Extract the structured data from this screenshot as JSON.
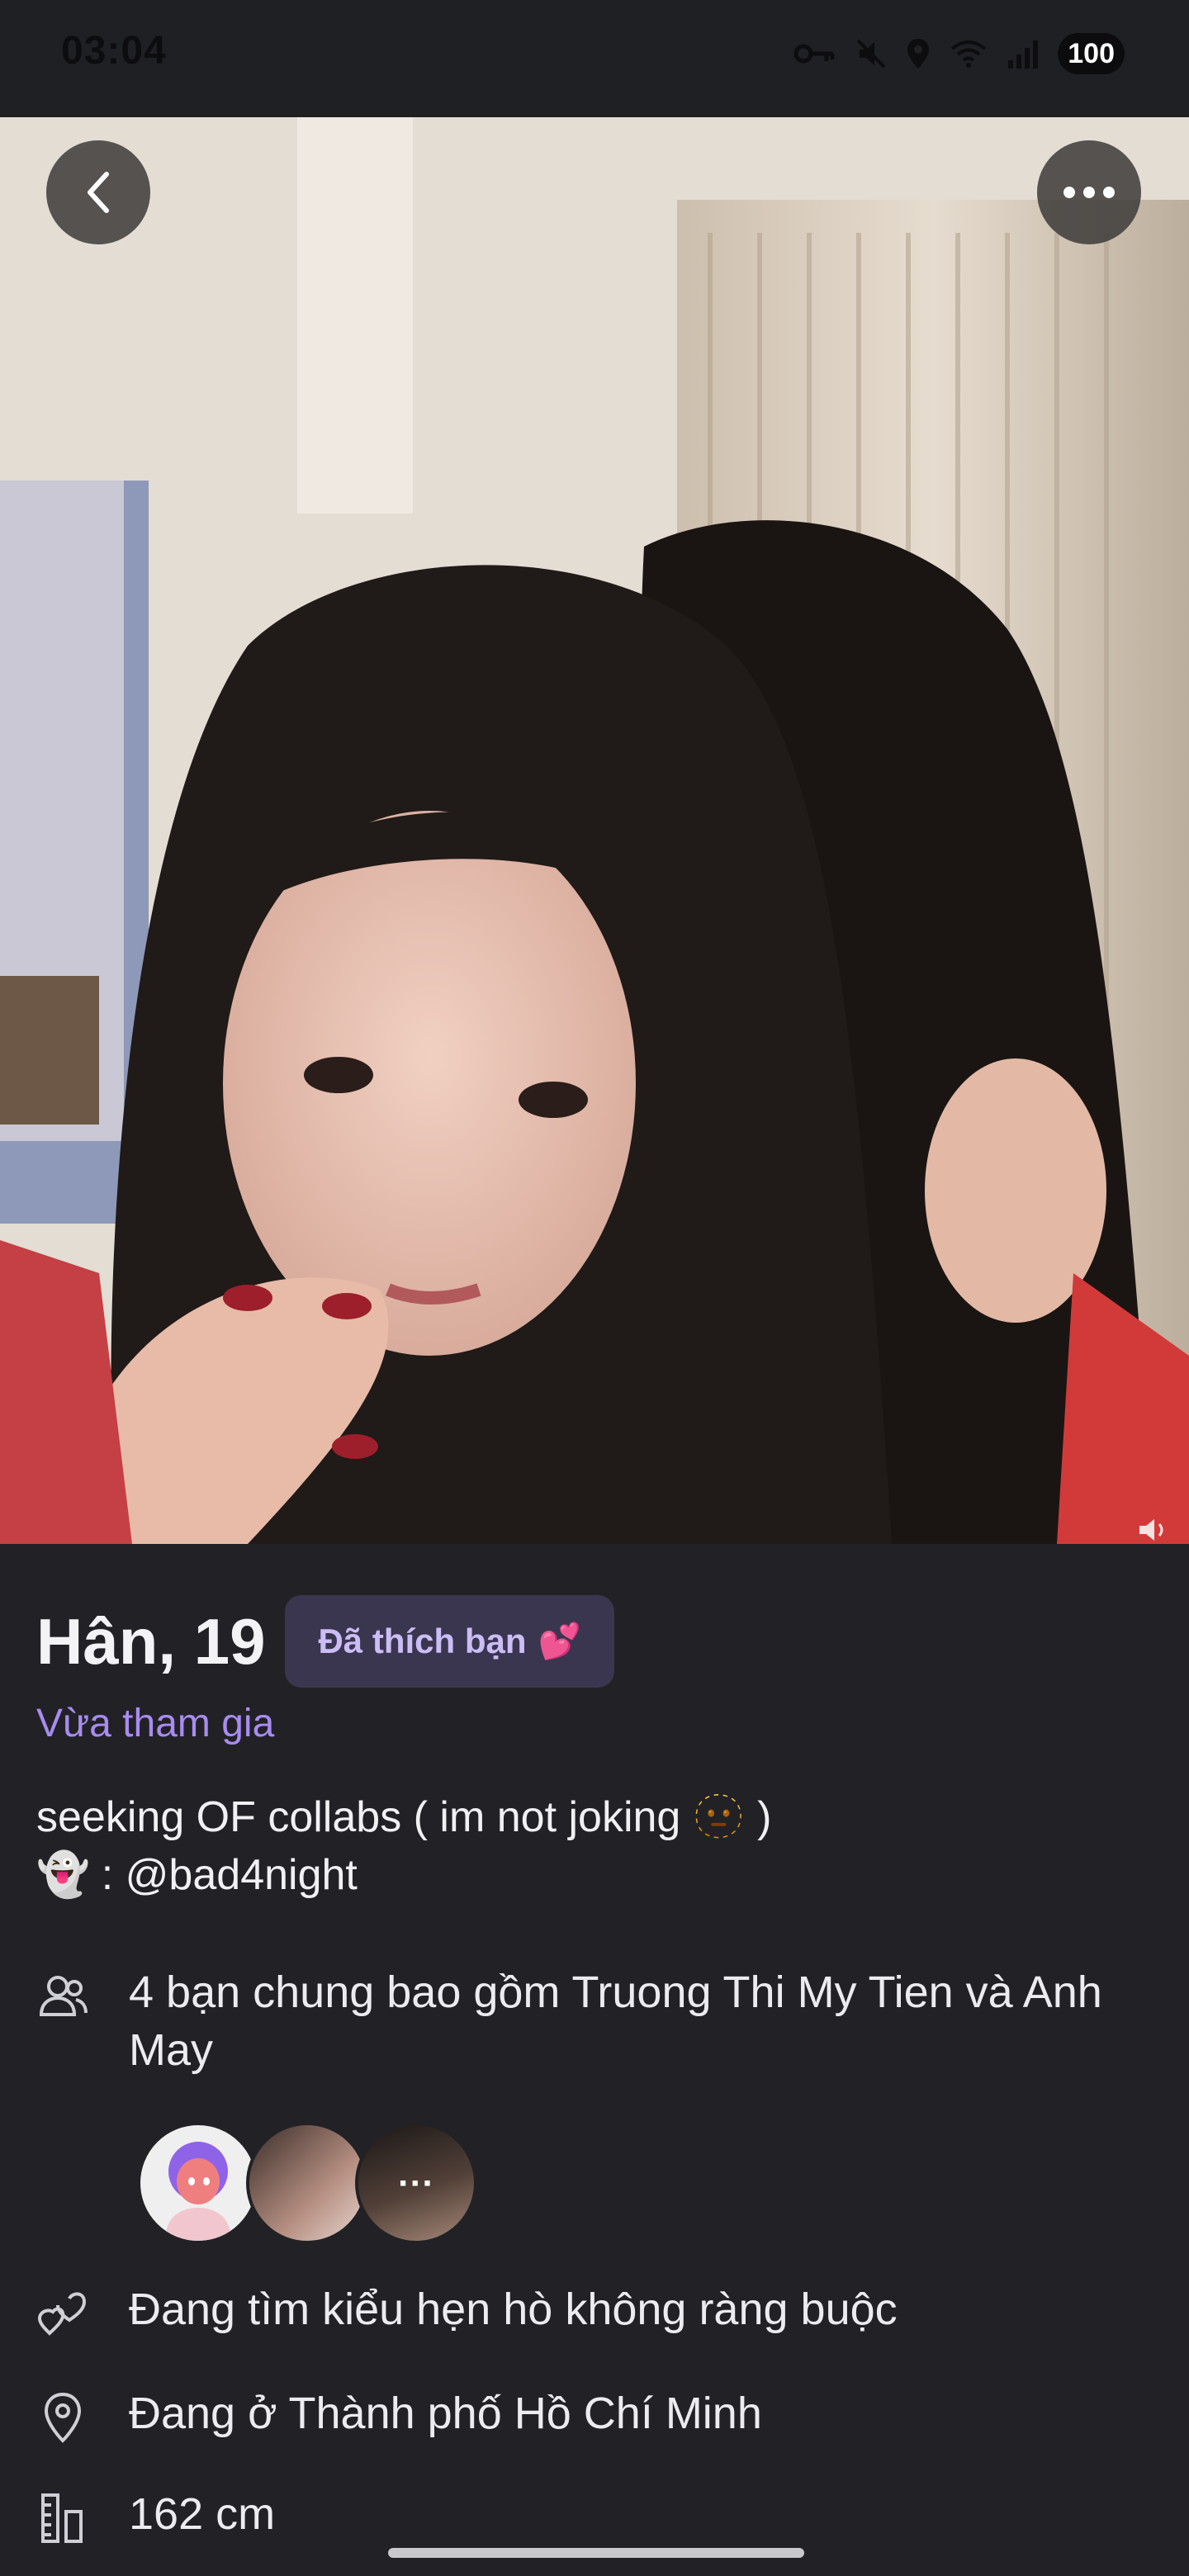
{
  "status_bar": {
    "time": "03:04",
    "battery": "100",
    "icons": [
      "vpn-key-icon",
      "mute-icon",
      "location-icon",
      "wifi-icon",
      "signal-icon"
    ]
  },
  "photo": {
    "back_icon": "chevron-left-icon",
    "more_icon": "more-horizontal-icon",
    "volume_icon": "volume-icon"
  },
  "profile": {
    "name_age": "Hân, 19",
    "liked_badge": "Đã thích bạn",
    "liked_badge_emoji": "💕",
    "recent_label": "Vừa tham gia",
    "bio_line1": "seeking OF collabs ( im not joking",
    "bio_line1_emoji": "🫥",
    "bio_line1_end": ")",
    "bio_line2_emoji": "👻",
    "bio_line2": ": @bad4night",
    "mutual_friends": "4 bạn chung bao gồm Truong Thi My Tien và Anh May",
    "mutual_more": "···",
    "seeking": "Đang tìm kiểu hẹn hò không ràng buộc",
    "location": "Đang ở Thành phố Hồ Chí Minh",
    "height": "162 cm"
  },
  "colors": {
    "background": "#222226",
    "accent": "#a88cf0",
    "badge_bg": "#3b3650"
  }
}
